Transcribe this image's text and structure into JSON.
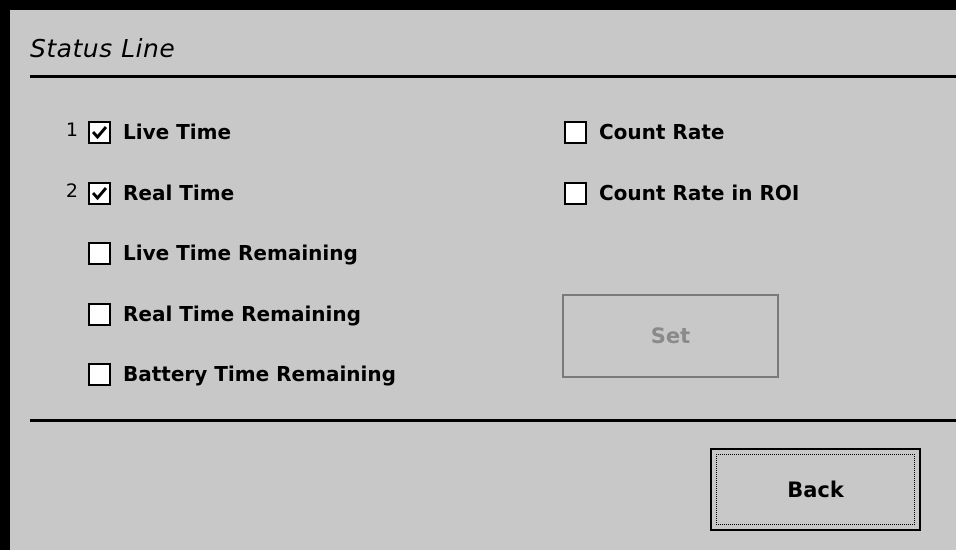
{
  "title": "Status Line",
  "left_options": [
    {
      "index": "1",
      "label": "Live Time",
      "checked": true
    },
    {
      "index": "2",
      "label": "Real Time",
      "checked": true
    },
    {
      "index": "",
      "label": "Live Time Remaining",
      "checked": false
    },
    {
      "index": "",
      "label": "Real Time Remaining",
      "checked": false
    },
    {
      "index": "",
      "label": "Battery Time Remaining",
      "checked": false
    }
  ],
  "right_options": [
    {
      "label": "Count Rate",
      "checked": false
    },
    {
      "label": "Count Rate in ROI",
      "checked": false
    }
  ],
  "set_button": {
    "label": "Set",
    "enabled": false
  },
  "back_button": {
    "label": "Back"
  }
}
